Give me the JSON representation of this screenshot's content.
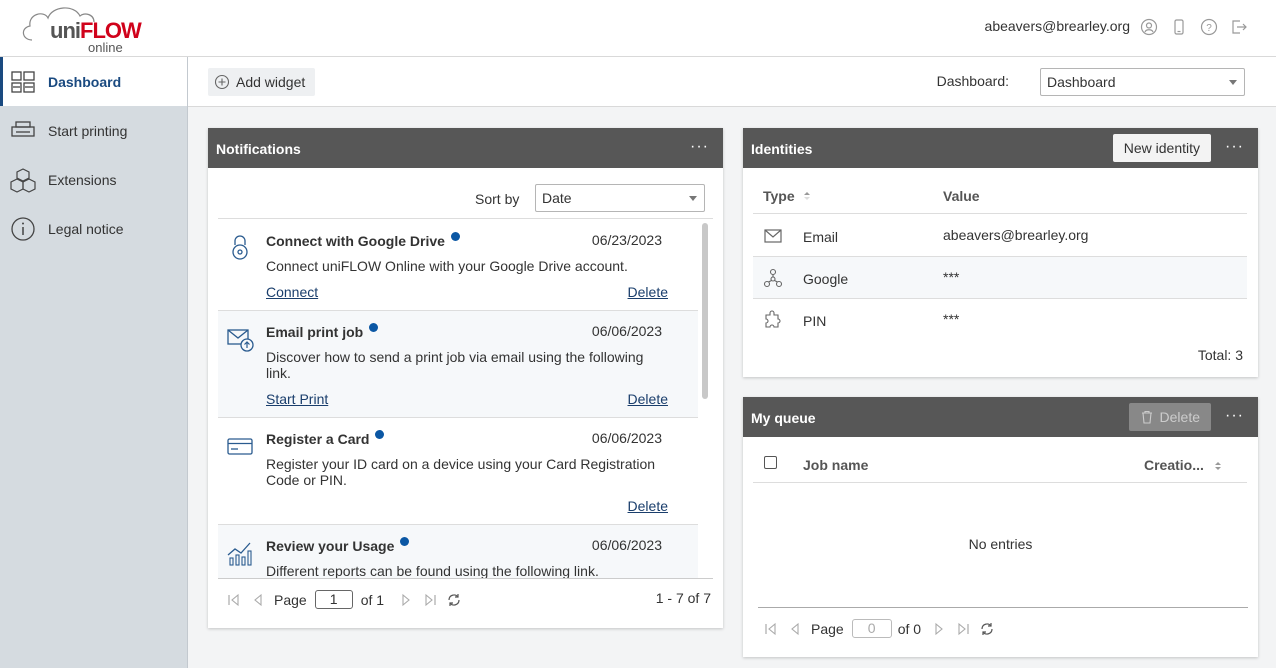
{
  "header": {
    "logo_uni": "uni",
    "logo_flow": "FLOW",
    "logo_online": "online",
    "user_email": "abeavers@brearley.org",
    "icons": [
      "user-icon",
      "mobile-icon",
      "help-icon",
      "logout-icon"
    ]
  },
  "sidebar": {
    "items": [
      {
        "label": "Dashboard",
        "icon": "dashboard-icon",
        "active": true
      },
      {
        "label": "Start printing",
        "icon": "printer-icon",
        "active": false
      },
      {
        "label": "Extensions",
        "icon": "cubes-icon",
        "active": false
      },
      {
        "label": "Legal notice",
        "icon": "info-icon",
        "active": false
      }
    ]
  },
  "toolbar": {
    "add_widget_label": "Add widget",
    "dashboard_label": "Dashboard:",
    "dashboard_value": "Dashboard"
  },
  "notifications": {
    "title": "Notifications",
    "more": "···",
    "sort_label": "Sort by",
    "sort_value": "Date",
    "items": [
      {
        "title": "Connect with Google Drive",
        "date": "06/23/2023",
        "text": "Connect uniFLOW Online with your Google Drive account.",
        "action": "Connect",
        "delete": "Delete",
        "icon": "lock-icon"
      },
      {
        "title": "Email print job",
        "date": "06/06/2023",
        "text": "Discover how to send a print job via email using the following link.",
        "action": "Start Print",
        "delete": "Delete",
        "icon": "email-upload-icon"
      },
      {
        "title": "Register a Card",
        "date": "06/06/2023",
        "text": "Register your ID card on a device using your Card Registration Code or PIN.",
        "action": "",
        "delete": "Delete",
        "icon": "card-icon"
      },
      {
        "title": "Review your Usage",
        "date": "06/06/2023",
        "text": "Different reports can be found using the following link.",
        "action": "",
        "delete": "",
        "icon": "chart-icon"
      }
    ],
    "pager": {
      "page_label": "Page",
      "page_value": "1",
      "of_label": "of 1",
      "range": "1 - 7 of 7"
    }
  },
  "identities": {
    "title": "Identities",
    "new_button": "New identity",
    "more": "···",
    "col_type": "Type",
    "col_value": "Value",
    "rows": [
      {
        "type": "Email",
        "value": "abeavers@brearley.org",
        "icon": "envelope-icon"
      },
      {
        "type": "Google",
        "value": "***",
        "icon": "google-network-icon"
      },
      {
        "type": "PIN",
        "value": "***",
        "icon": "pin-puzzle-icon"
      }
    ],
    "total": "Total: 3"
  },
  "queue": {
    "title": "My queue",
    "delete_button": "Delete",
    "more": "···",
    "col_job": "Job name",
    "col_created": "Creatio...",
    "empty": "No entries",
    "pager": {
      "page_label": "Page",
      "page_value": "0",
      "of_label": "of 0"
    }
  }
}
